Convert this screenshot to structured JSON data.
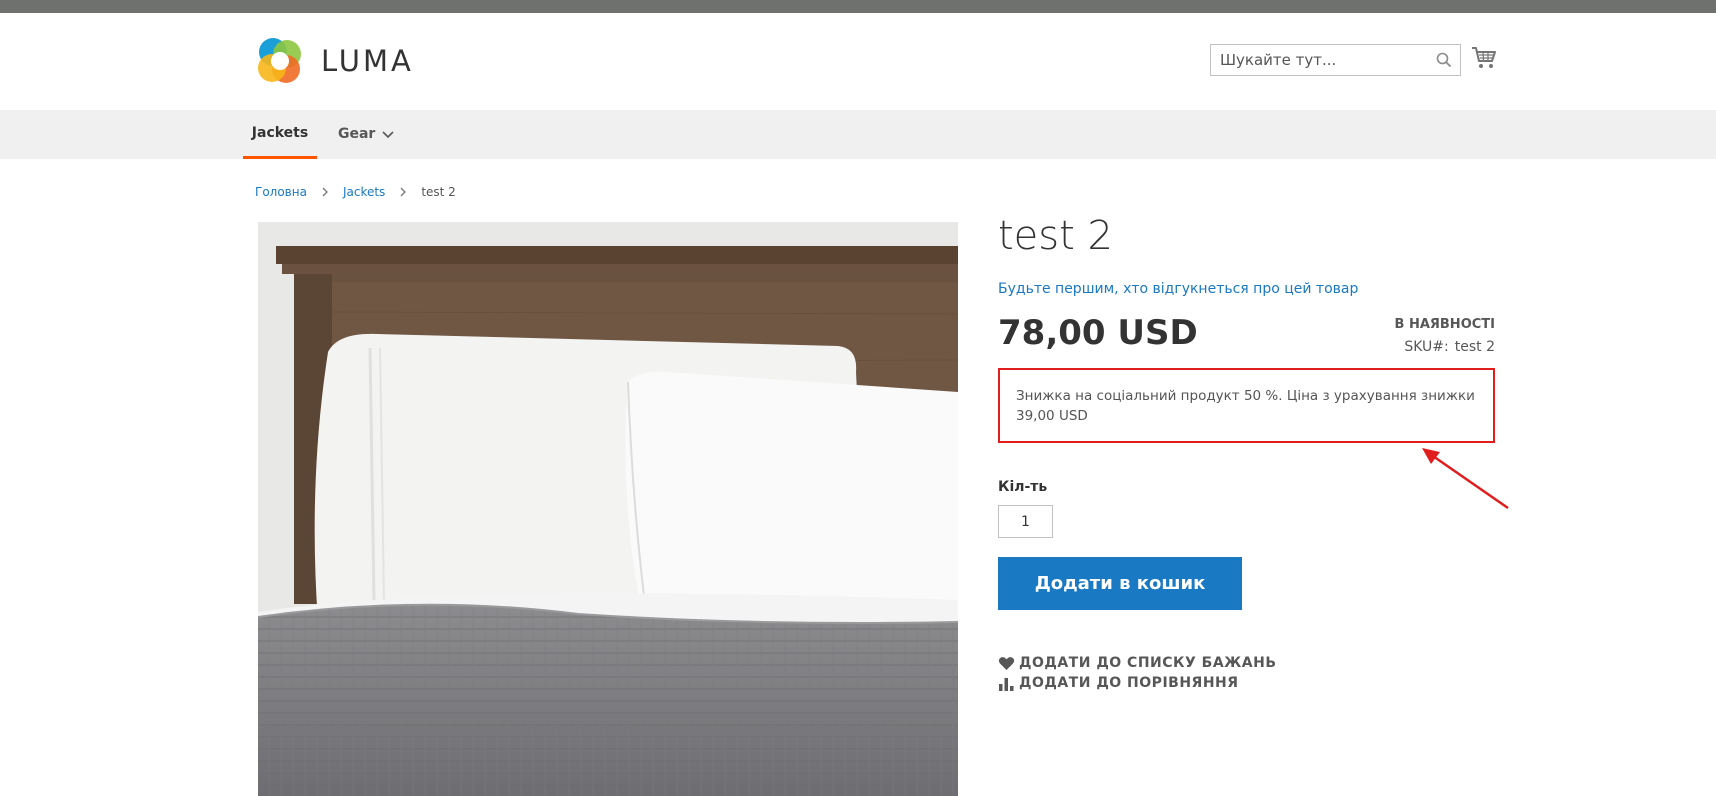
{
  "header": {
    "logo_text": "LUMA",
    "search_placeholder": "Шукайте тут...",
    "colors": {
      "accent": "#ff5501",
      "link": "#1979c3",
      "topbar": "#6e716e"
    }
  },
  "nav": {
    "items": [
      {
        "label": "Jackets",
        "active": true
      },
      {
        "label": "Gear",
        "active": false
      }
    ]
  },
  "breadcrumb": {
    "home": "Головна",
    "category": "Jackets",
    "current": "test 2"
  },
  "product": {
    "title": "test 2",
    "review_link": "Будьте першим, хто відгукнеться про цей товар",
    "price": "78,00 USD",
    "stock": "В НАЯВНОСТІ",
    "sku_label": "SKU#:",
    "sku_value": "test 2",
    "discount_text": "Знижка на соціальний продукт 50 %. Ціна з урахування знижки 39,00 USD",
    "qty_label": "Кіл-ть",
    "qty_value": "1",
    "add_to_cart": "Додати в кошик",
    "wishlist": "ДОДАТИ ДО СПИСКУ БАЖАНЬ",
    "compare": "ДОДАТИ ДО ПОРІВНЯННЯ"
  }
}
